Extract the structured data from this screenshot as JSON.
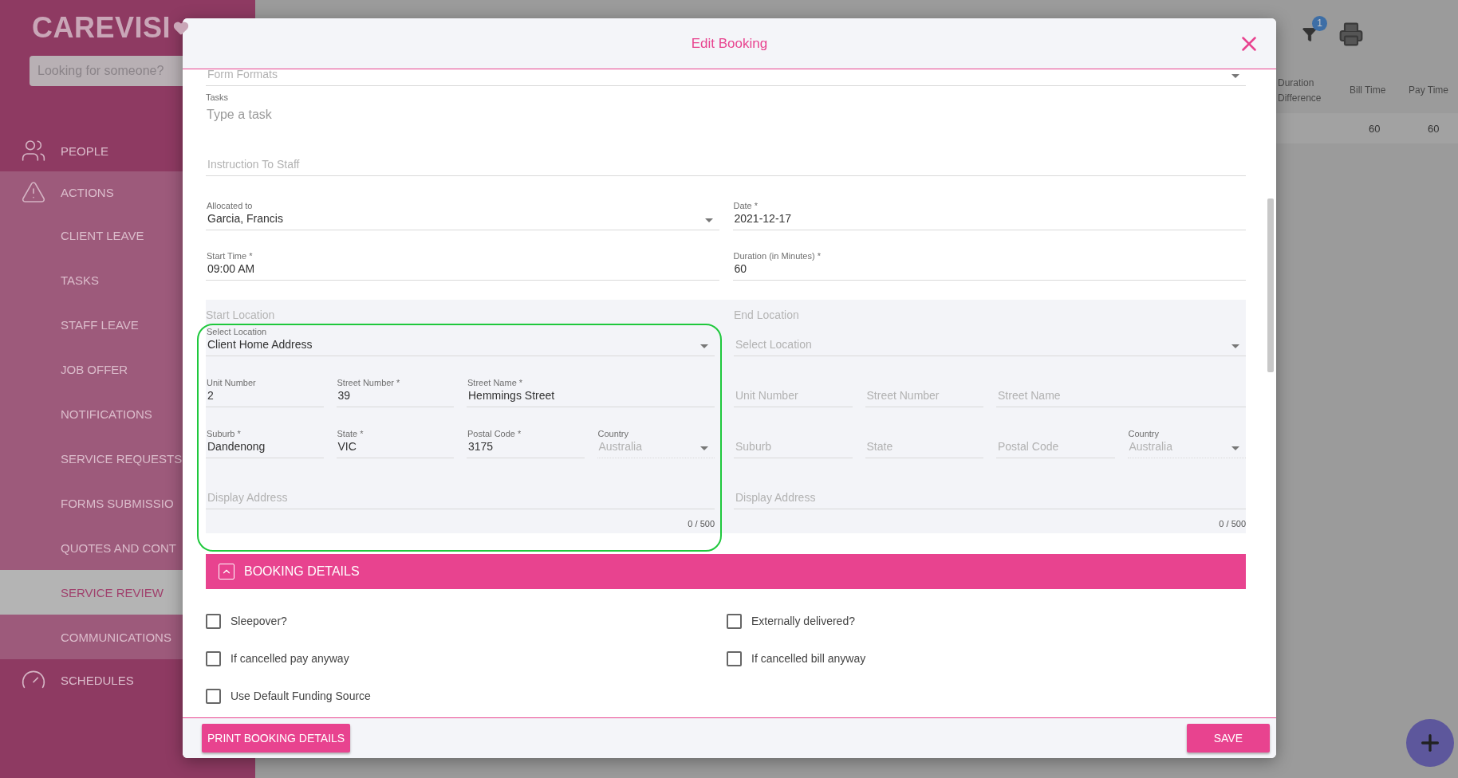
{
  "sidebar": {
    "logo": "CAREVISI",
    "search": {
      "placeholder": "Looking for someone?"
    },
    "sections": [
      {
        "label": "PEOPLE",
        "selected": false,
        "expanded": false
      },
      {
        "label": "ACTIONS",
        "selected": false,
        "expanded": true,
        "children": [
          {
            "label": "CLIENT LEAVE",
            "selected": false
          },
          {
            "label": "TASKS",
            "selected": false
          },
          {
            "label": "STAFF LEAVE",
            "selected": false
          },
          {
            "label": "JOB OFFER",
            "selected": false
          },
          {
            "label": "NOTIFICATIONS",
            "selected": false
          },
          {
            "label": "SERVICE REQUESTS",
            "selected": false
          },
          {
            "label": "FORMS SUBMISSIO",
            "selected": false
          },
          {
            "label": "QUOTES AND CONT",
            "selected": false
          },
          {
            "label": "SERVICE REVIEW",
            "selected": true
          },
          {
            "label": "COMMUNICATIONS",
            "selected": false
          }
        ]
      },
      {
        "label": "SCHEDULES",
        "selected": false,
        "expanded": false
      }
    ]
  },
  "toolbar": {
    "filter_count": "1"
  },
  "table": {
    "columns": [
      "Duration Difference",
      "Bill Time",
      "Pay Time"
    ],
    "rows": [
      {
        "bill_time": "60",
        "pay_time": "60"
      }
    ]
  },
  "modal": {
    "title": "Edit Booking",
    "top_fields": [
      {
        "kind": "select",
        "placeholder": "Form Formats"
      },
      {
        "kind": "tasks",
        "label": "Tasks",
        "placeholder": "Type a task"
      },
      {
        "kind": "text",
        "placeholder": "Instruction To Staff"
      }
    ],
    "field_rows": [
      [
        {
          "kind": "select",
          "label": "Allocated to",
          "value": "Garcia, Francis"
        },
        {
          "kind": "text",
          "label": "Date *",
          "value": "2021-12-17"
        }
      ],
      [
        {
          "kind": "text",
          "label": "Start Time *",
          "value": "09:00 AM"
        },
        {
          "kind": "text",
          "label": "Duration (in Minutes) *",
          "value": "60"
        }
      ]
    ],
    "locations": [
      {
        "title": "Start Location",
        "highlighted": true,
        "select": {
          "label": "Select Location",
          "value": "Client Home Address"
        },
        "fields": [
          {
            "kind": "text",
            "label": "Unit Number",
            "value": "2"
          },
          {
            "kind": "text",
            "label": "Street Number *",
            "value": "39"
          },
          {
            "kind": "wide",
            "label": "Street Name *",
            "value": "Hemmings Street"
          },
          {
            "kind": "text",
            "label": "Suburb *",
            "value": "Dandenong"
          },
          {
            "kind": "text",
            "label": "State *",
            "value": "VIC"
          },
          {
            "kind": "text",
            "label": "Postal Code *",
            "value": "3175"
          },
          {
            "kind": "select",
            "label": "Country",
            "placeholder": "Australia",
            "disabled": true
          }
        ],
        "display_address": {
          "placeholder": "Display Address",
          "counter": "0 / 500"
        }
      },
      {
        "title": "End Location",
        "select": {
          "placeholder": "Select Location"
        },
        "fields": [
          {
            "kind": "text",
            "placeholder": "Unit Number"
          },
          {
            "kind": "text",
            "placeholder": "Street Number"
          },
          {
            "kind": "wide",
            "placeholder": "Street Name"
          },
          {
            "kind": "text",
            "placeholder": "Suburb"
          },
          {
            "kind": "text",
            "placeholder": "State"
          },
          {
            "kind": "text",
            "placeholder": "Postal Code"
          },
          {
            "kind": "select",
            "label": "Country",
            "placeholder": "Australia",
            "disabled": true
          }
        ],
        "display_address": {
          "placeholder": "Display Address",
          "counter": "0 / 500"
        }
      }
    ],
    "booking_details": {
      "title": "BOOKING DETAILS",
      "expanded": true
    },
    "checkboxes": [
      {
        "label": "Sleepover?",
        "checked": false
      },
      {
        "label": "Externally delivered?",
        "checked": false
      },
      {
        "label": "If cancelled pay anyway",
        "checked": false
      },
      {
        "label": "If cancelled bill anyway",
        "checked": false
      },
      {
        "label": "Use Default Funding Source",
        "checked": false
      }
    ],
    "buttons": [
      {
        "label": "PRINT BOOKING DETAILS",
        "kind": "secondary"
      },
      {
        "label": "SAVE",
        "kind": "primary"
      }
    ]
  }
}
